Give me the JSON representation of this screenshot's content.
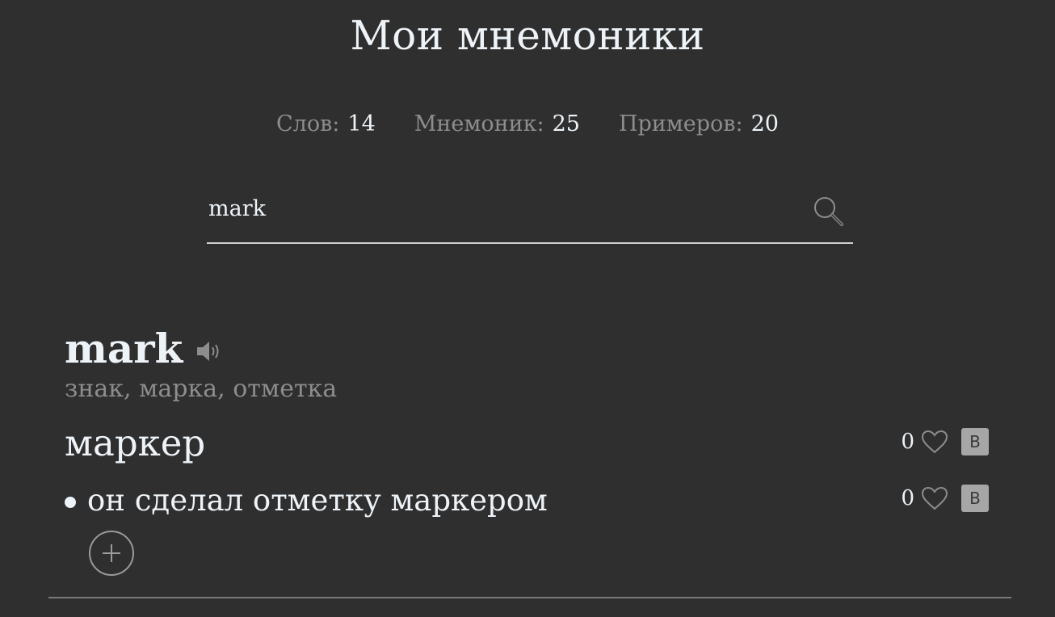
{
  "page": {
    "title": "Мои мнемоники"
  },
  "stats": {
    "words_label": "Слов:",
    "words_value": "14",
    "mnemonics_label": "Мнемоник:",
    "mnemonics_value": "25",
    "examples_label": "Примеров:",
    "examples_value": "20"
  },
  "search": {
    "value": "mark",
    "icon": "search-icon"
  },
  "entry": {
    "word": "mark",
    "speaker_icon": "speaker-icon",
    "translation": "знак, марка, отметка",
    "mnemonic": {
      "text": "маркер",
      "likes": "0",
      "badge": "B"
    },
    "example": {
      "text": "он сделал отметку маркером",
      "likes": "0",
      "badge": "B"
    },
    "add_icon": "plus-icon"
  },
  "colors": {
    "background": "#2f2f2f",
    "text": "#eef3f8",
    "muted": "#8d8d8d",
    "badge": "#a6a6a6"
  }
}
